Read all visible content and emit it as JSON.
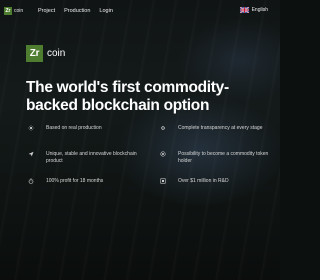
{
  "header": {
    "logo_mark": "Zr",
    "logo_text": "coin",
    "nav": [
      {
        "label": "Project"
      },
      {
        "label": "Production"
      },
      {
        "label": "Login"
      }
    ],
    "language": {
      "label": "English",
      "icon": "uk-flag-icon"
    }
  },
  "hero": {
    "brand_mark": "Zr",
    "brand_text": "coin",
    "headline": "The world's first commodity-backed blockchain option"
  },
  "features": [
    {
      "text": "Based on real production",
      "icon": "sun-icon"
    },
    {
      "text": "Complete transparency at every stage",
      "icon": "gear-icon"
    },
    {
      "text": "Unique, stable and innovative blockchain product",
      "icon": "send-icon"
    },
    {
      "text": "Possibility to become a commodity token holder",
      "icon": "coin-icon"
    },
    {
      "text": "100% profit for 18 months",
      "icon": "stopwatch-icon"
    },
    {
      "text": "Over $1 million in R&D",
      "icon": "box-icon"
    }
  ],
  "colors": {
    "brand_green": "#4e7d2f",
    "background": "#0c100e",
    "text": "#ffffff"
  }
}
